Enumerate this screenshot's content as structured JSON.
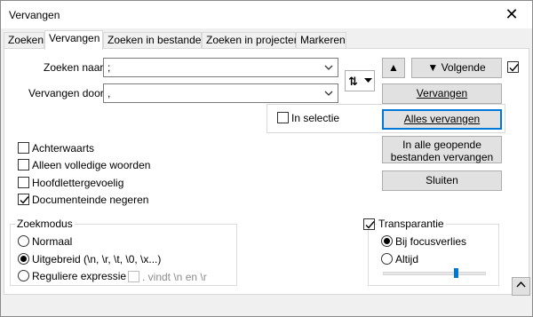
{
  "window": {
    "title": "Vervangen",
    "close_glyph": "✕"
  },
  "tabs": [
    {
      "label": "Zoeken",
      "active": false
    },
    {
      "label": "Vervangen",
      "active": true
    },
    {
      "label": "Zoeken in bestanden",
      "active": false
    },
    {
      "label": "Zoeken in projecten",
      "active": false
    },
    {
      "label": "Markeren",
      "active": false
    }
  ],
  "find": {
    "label": "Zoeken naar:",
    "value": ";"
  },
  "replace": {
    "label": "Vervangen door:",
    "value": ","
  },
  "swap_button": {
    "icon": "swap-updown-icon",
    "glyph": "⇅"
  },
  "buttons": {
    "prev_glyph": "▲",
    "next_label": "▼ Volgende",
    "replace": "Vervangen",
    "replace_all": "Alles vervangen",
    "replace_all_open_line1": "In alle geopende",
    "replace_all_open_line2": "bestanden vervangen",
    "close": "Sluiten",
    "collapse_glyph": "^"
  },
  "wrap_checkbox_checked": true,
  "in_selection": {
    "label": "In selectie",
    "checked": false
  },
  "options": [
    {
      "label": "Achterwaarts",
      "checked": false
    },
    {
      "label": "Alleen volledige woorden",
      "checked": false
    },
    {
      "label": "Hoofdlettergevoelig",
      "checked": false
    },
    {
      "label": "Documenteinde negeren",
      "checked": true
    }
  ],
  "search_mode": {
    "title": "Zoekmodus",
    "options": [
      {
        "label": "Normaal",
        "selected": false
      },
      {
        "label": "Uitgebreid (\\n, \\r, \\t, \\0, \\x...)",
        "selected": true
      },
      {
        "label": "Reguliere expressie",
        "selected": false
      }
    ],
    "dot_newline_label": ". vindt \\n en \\r"
  },
  "transparency": {
    "label": "Transparantie",
    "checked": true,
    "options": [
      {
        "label": "Bij focusverlies",
        "selected": true
      },
      {
        "label": "Altijd",
        "selected": false
      }
    ],
    "slider_value": 0.7
  },
  "colors": {
    "accent": "#0078d7"
  }
}
